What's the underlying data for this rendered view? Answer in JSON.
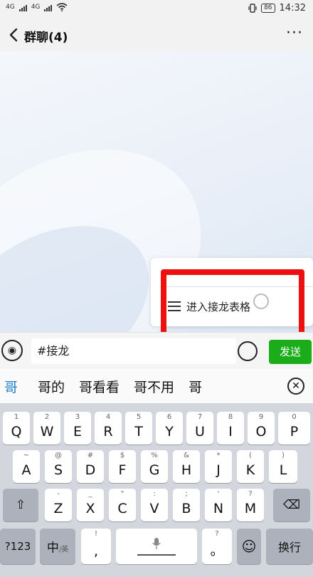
{
  "status": {
    "sim1": "4G",
    "sim2": "4G",
    "battery": "86",
    "time": "14:32"
  },
  "nav": {
    "back_icon": "chevron-left-icon",
    "title": "群聊(4)",
    "more_label": "···"
  },
  "popup": {
    "item_icon": "list-icon",
    "item_label": "进入接龙表格"
  },
  "composer": {
    "voice_icon": "voice-icon",
    "input_value": "#接龙",
    "send_label": "发送"
  },
  "candidates": {
    "items": [
      "哥",
      "哥的",
      "哥看看",
      "哥不用",
      "哥"
    ],
    "close_label": "✕"
  },
  "keyboard": {
    "row1": [
      {
        "main": "Q",
        "alt": "1"
      },
      {
        "main": "W",
        "alt": "2"
      },
      {
        "main": "E",
        "alt": "3"
      },
      {
        "main": "R",
        "alt": "4"
      },
      {
        "main": "T",
        "alt": "5"
      },
      {
        "main": "Y",
        "alt": "6"
      },
      {
        "main": "U",
        "alt": "7"
      },
      {
        "main": "I",
        "alt": "8"
      },
      {
        "main": "O",
        "alt": "9"
      },
      {
        "main": "P",
        "alt": "0"
      }
    ],
    "row2": [
      {
        "main": "A",
        "alt": "~"
      },
      {
        "main": "S",
        "alt": "@"
      },
      {
        "main": "D",
        "alt": "#"
      },
      {
        "main": "F",
        "alt": "$"
      },
      {
        "main": "G",
        "alt": "%"
      },
      {
        "main": "H",
        "alt": "&"
      },
      {
        "main": "J",
        "alt": "*"
      },
      {
        "main": "K",
        "alt": "("
      },
      {
        "main": "L",
        "alt": ")"
      }
    ],
    "row3": [
      {
        "main": "Z",
        "alt": "-"
      },
      {
        "main": "X",
        "alt": "_"
      },
      {
        "main": "C",
        "alt": "\""
      },
      {
        "main": "V",
        "alt": ":"
      },
      {
        "main": "B",
        "alt": ";"
      },
      {
        "main": "N",
        "alt": "'"
      },
      {
        "main": "M",
        "alt": "?"
      }
    ],
    "shift_label": "⇧",
    "delete_label": "⌫",
    "sym_label": "?123",
    "lang_label": "中",
    "lang_sub": "/英",
    "comma_label": ",",
    "comma_alt": "!",
    "space_icon": "microphone-icon",
    "period_label": "。",
    "period_alt": "?",
    "emoji_label": "☺",
    "enter_label": "换行"
  },
  "colors": {
    "send_green": "#1aad19",
    "highlight_red": "#ee1010",
    "candidate_blue": "#1e7ec8"
  }
}
